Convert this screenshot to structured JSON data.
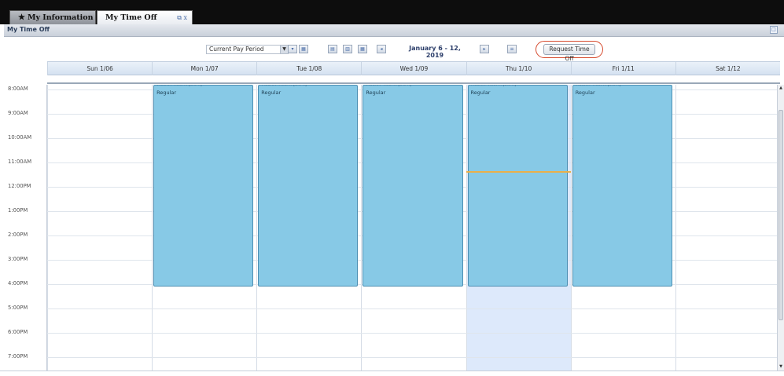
{
  "tabs": [
    {
      "label": "My Information",
      "icon": "star-icon"
    },
    {
      "label": "My Time Off",
      "tools": "⧉ x"
    }
  ],
  "window": {
    "title": "My Time Off"
  },
  "toolbar": {
    "period": "Current Pay Period",
    "date_range": "January 6 - 12, 2019",
    "request_label": "Request Time Off"
  },
  "days": [
    {
      "label": "Sun 1/06"
    },
    {
      "label": "Mon 1/07"
    },
    {
      "label": "Tue 1/08"
    },
    {
      "label": "Wed 1/09"
    },
    {
      "label": "Thu 1/10"
    },
    {
      "label": "Fri 1/11"
    },
    {
      "label": "Sat 1/12"
    }
  ],
  "times": [
    "8:00AM",
    "9:00AM",
    "10:00AM",
    "11:00AM",
    "12:00PM",
    "1:00PM",
    "2:00PM",
    "3:00PM",
    "4:00PM",
    "5:00PM",
    "6:00PM",
    "7:00PM"
  ],
  "events": [
    {
      "day": 1,
      "label": "Regular",
      "time": "7:30AM-4:00PM [8.5 h]"
    },
    {
      "day": 2,
      "label": "Regular",
      "time": "7:30AM-4:00PM [8.5 h]"
    },
    {
      "day": 3,
      "label": "Regular",
      "time": "7:30AM-4:00PM [8.5 h]"
    },
    {
      "day": 4,
      "label": "Regular",
      "time": "7:30AM-4:00PM [8.5 h]"
    },
    {
      "day": 5,
      "label": "Regular",
      "time": "7:30AM-4:00PM [8.5 h]"
    }
  ],
  "today_index": 4,
  "colors": {
    "event_fill": "#87c9e6",
    "today_fill": "#dde9fb",
    "now_line": "#e9b04a",
    "request_highlight": "#d64a2e"
  }
}
